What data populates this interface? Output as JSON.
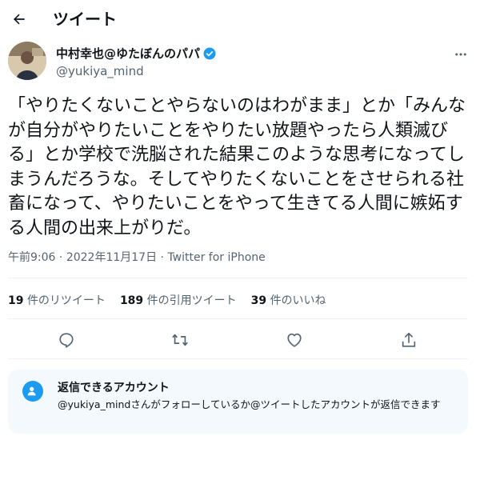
{
  "header": {
    "title": "ツイート",
    "back_icon": "arrow-left-icon"
  },
  "author": {
    "display_name": "中村幸也@ゆたぼんのパパ",
    "handle": "@yukiya_mind",
    "verified_icon": "verified-badge-icon",
    "more_icon": "more-horizontal-icon"
  },
  "tweet": {
    "text": "「やりたくないことやらないのはわがまま」とか「みんなが自分がやりたいことをやりたい放題やったら人類滅びる」とか学校で洗脳された結果このような思考になってしまうんだろうな。そしてやりたくないことをさせられる社畜になって、やりたいことをやって生きてる人間に嫉妬する人間の出来上がりだ。",
    "time": "午前9:06",
    "separator": "·",
    "date": "2022年11月17日",
    "source": "Twitter for iPhone"
  },
  "stats": {
    "retweets": {
      "count": "19",
      "label": "件のリツイート"
    },
    "quotes": {
      "count": "189",
      "label": "件の引用ツイート"
    },
    "likes": {
      "count": "39",
      "label": "件のいいね"
    }
  },
  "actions": [
    "reply-icon",
    "retweet-icon",
    "like-icon",
    "share-icon"
  ],
  "reply_restriction": {
    "icon": "at-person-icon",
    "title": "返信できるアカウント",
    "description": "@yukiya_mindさんがフォローしているか@ツイートしたアカウントが返信できます"
  },
  "colors": {
    "accent": "#1d9bf0",
    "secondary_text": "#536471",
    "reply_box_bg": "#f3f9fd"
  }
}
